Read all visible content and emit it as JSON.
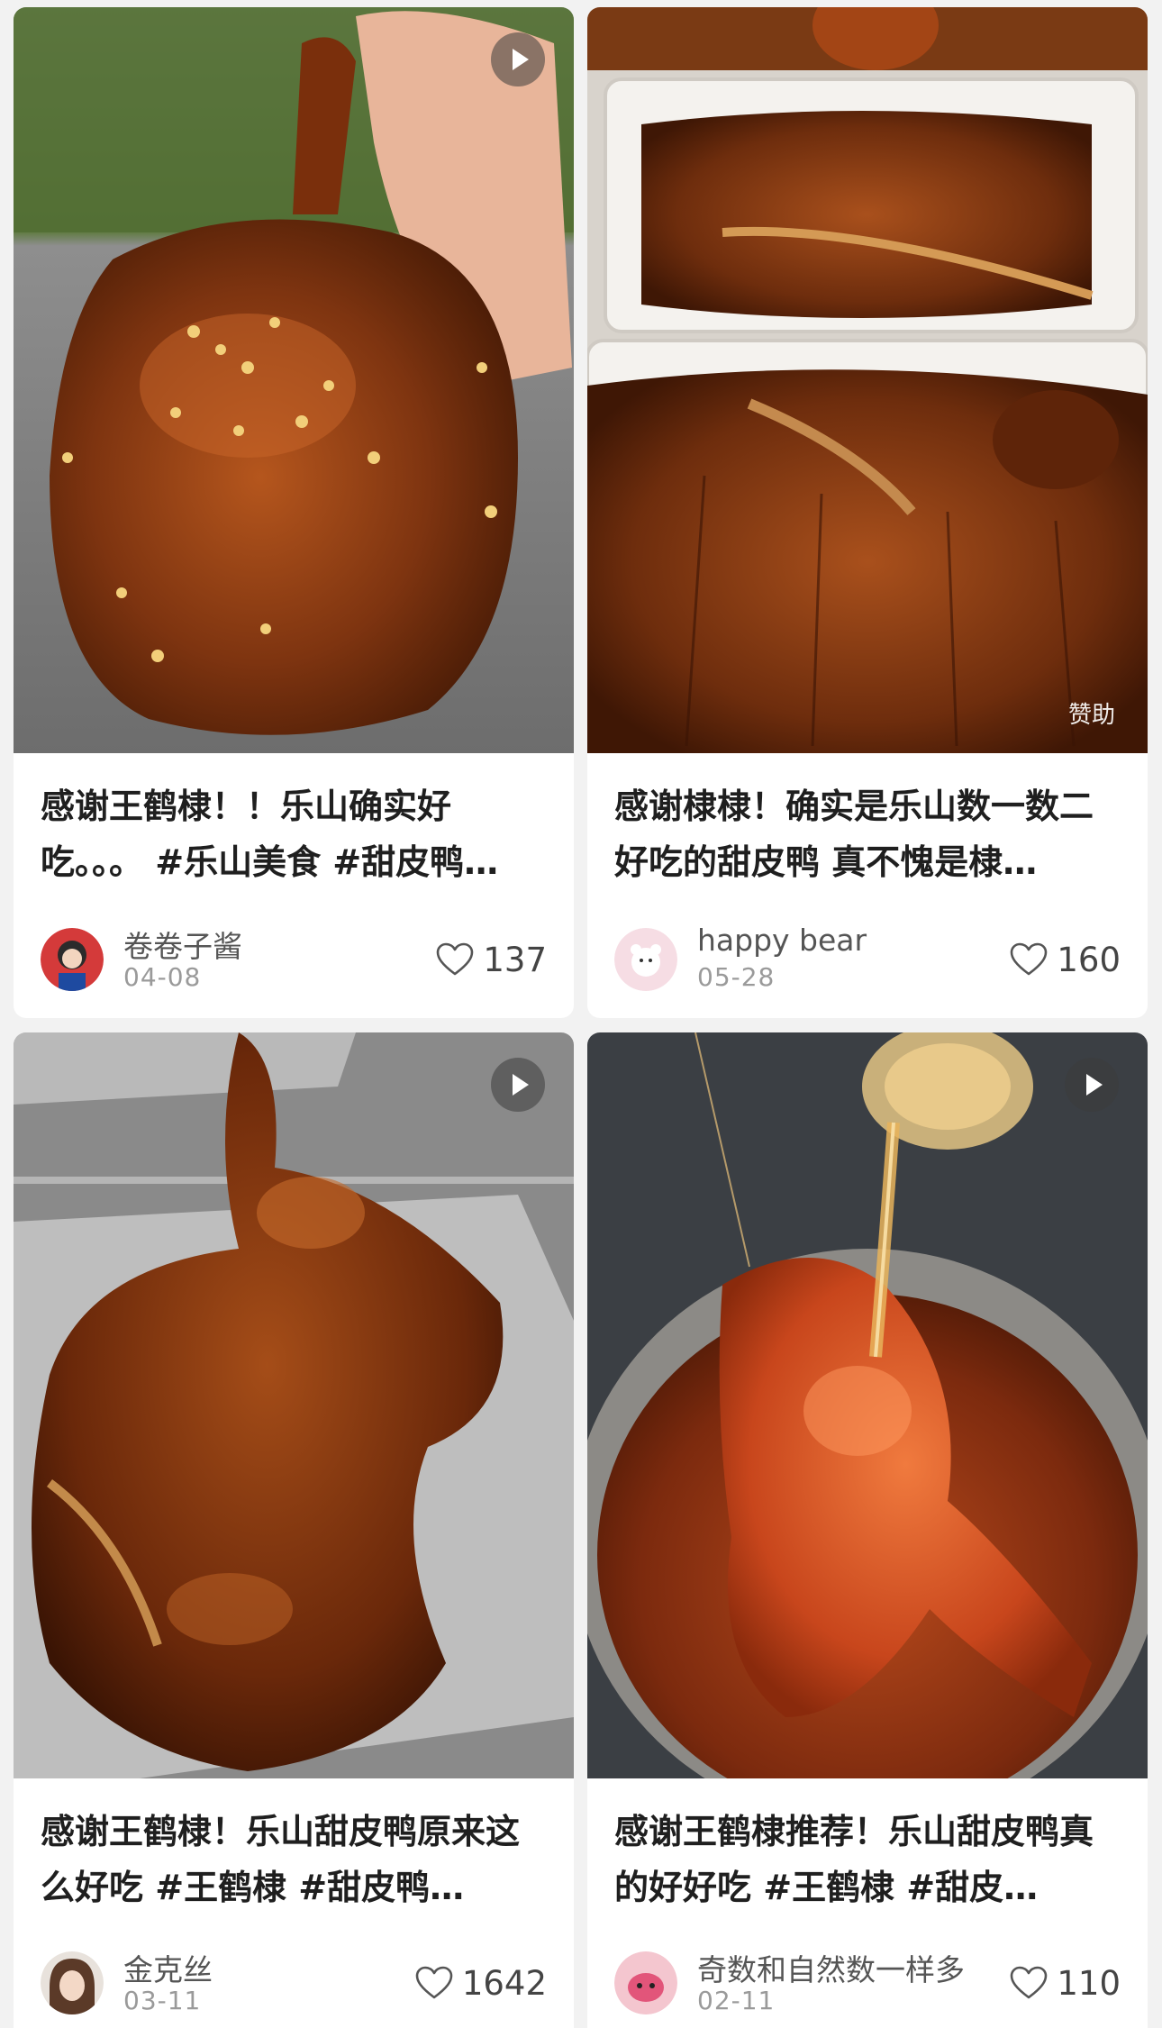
{
  "feed": {
    "cards": [
      {
        "title": "感谢王鹤棣！！乐山确实好吃。。。 #乐山美食 #甜皮鸭…",
        "author": "卷卷子酱",
        "date": "04-08",
        "likes": "137",
        "is_video": true,
        "badge": "",
        "image_icon": "duck-leg-photo-icon"
      },
      {
        "title": "感谢棣棣！确实是乐山数一数二好吃的甜皮鸭 真不愧是棣…",
        "author": "happy bear",
        "date": "05-28",
        "likes": "160",
        "is_video": false,
        "badge": "赞助",
        "image_icon": "duck-boxes-photo-icon"
      },
      {
        "title": "感谢王鹤棣！乐山甜皮鸭原来这么好吃 #王鹤棣 #甜皮鸭…",
        "author": "金克丝",
        "date": "03-11",
        "likes": "1642",
        "is_video": true,
        "badge": "",
        "image_icon": "duck-box-photo-icon"
      },
      {
        "title": "感谢王鹤棣推荐！乐山甜皮鸭真的好好吃 #王鹤棣 #甜皮…",
        "author": "奇数和自然数一样多",
        "date": "02-11",
        "likes": "110",
        "is_video": true,
        "badge": "",
        "image_icon": "duck-syrup-pot-photo-icon"
      }
    ]
  },
  "colors": {
    "background": "#f2f2f2",
    "card": "#ffffff",
    "title_text": "#1f1f1f",
    "meta_text": "#9a9a9a",
    "duck_glaze": "#8a3a12"
  }
}
